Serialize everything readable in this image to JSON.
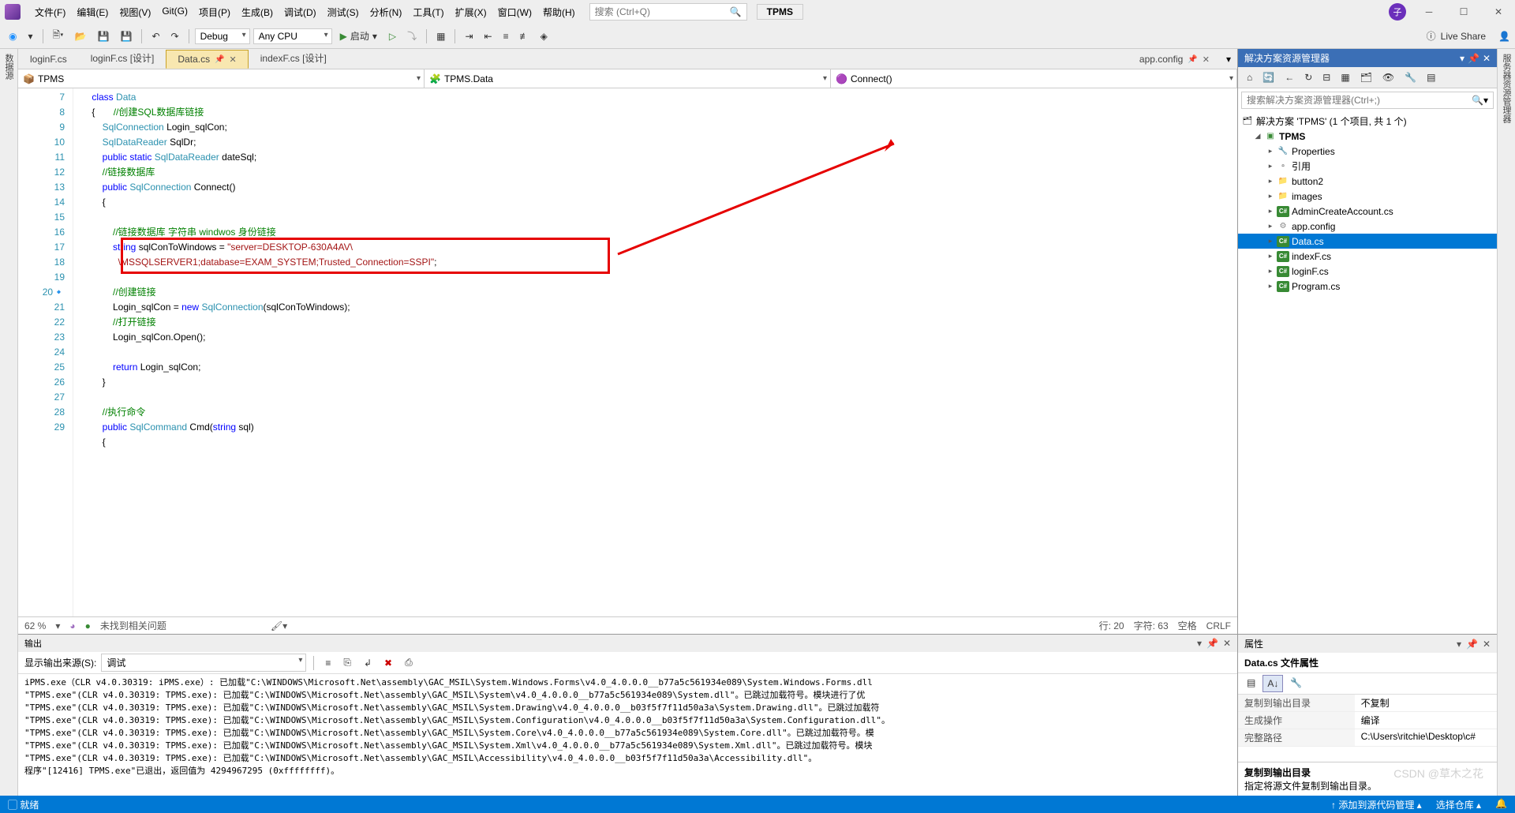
{
  "menu": [
    "文件(F)",
    "编辑(E)",
    "视图(V)",
    "Git(G)",
    "项目(P)",
    "生成(B)",
    "调试(D)",
    "测试(S)",
    "分析(N)",
    "工具(T)",
    "扩展(X)",
    "窗口(W)",
    "帮助(H)"
  ],
  "search_placeholder": "搜索 (Ctrl+Q)",
  "solution_name": "TPMS",
  "user_initial": "子",
  "toolbar": {
    "config": "Debug",
    "platform": "Any CPU",
    "start": "启动"
  },
  "liveshare": "Live Share",
  "left_tool": "数据源",
  "right_tool": "服务器资源管理器",
  "tabs": [
    {
      "label": "loginF.cs",
      "active": false
    },
    {
      "label": "loginF.cs [设计]",
      "active": false
    },
    {
      "label": "Data.cs",
      "active": true,
      "pinned": true
    },
    {
      "label": "indexF.cs [设计]",
      "active": false
    }
  ],
  "extra_tab": "app.config",
  "nav": {
    "ns": "TPMS",
    "cls": "TPMS.Data",
    "member": "Connect()"
  },
  "line_start": 7,
  "line_count": 23,
  "code_lines": [
    "    <span class='kw'>class</span> <span class='type'>Data</span>",
    "    {       <span class='cmt'>//创建SQL数据库链接</span>",
    "        <span class='type'>SqlConnection</span> Login_sqlCon;",
    "        <span class='type'>SqlDataReader</span> SqlDr;",
    "        <span class='kw'>public static</span> <span class='type'>SqlDataReader</span> dateSql;",
    "        <span class='cmt'>//链接数据库</span>",
    "        <span class='kw'>public</span> <span class='type'>SqlConnection</span> Connect()",
    "        {",
    "",
    "            <span class='cmt'>//链接数据库 字符串 windwos 身份链接</span>",
    "            <span class='kw'>string</span> sqlConToWindows = <span class='str'>\"server=DESKTOP-630A4AV\\</span>",
    "<span class='str'>              \\MSSQLSERVER1;database=EXAM_SYSTEM;Trusted_Connection=SSPI\"</span>;",
    "",
    "            <span class='cmt'>//创建链接</span>",
    "            Login_sqlCon = <span class='kw'>new</span> <span class='type'>SqlConnection</span>(sqlConToWindows);",
    "            <span class='cmt'>//打开链接</span>",
    "            Login_sqlCon.Open();",
    "",
    "            <span class='kw'>return</span> Login_sqlCon;",
    "        }",
    "",
    "        <span class='cmt'>//执行命令</span>",
    "        <span class='kw'>public</span> <span class='type'>SqlCommand</span> Cmd(<span class='kw'>string</span> sql)",
    "        {"
  ],
  "status": {
    "zoom": "62 %",
    "issues": "未找到相关问题",
    "line": "行: 20",
    "col": "字符: 63",
    "spc": "空格",
    "eol": "CRLF"
  },
  "output": {
    "title": "输出",
    "from_label": "显示输出来源(S):",
    "from_value": "调试",
    "lines": [
      "iPMS.exe（CLR v4.0.30319: iPMS.exe）: 已加载\"C:\\WINDOWS\\Microsoft.Net\\assembly\\GAC_MSIL\\System.Windows.Forms\\v4.0_4.0.0.0__b77a5c561934e089\\System.Windows.Forms.dll",
      "\"TPMS.exe\"(CLR v4.0.30319: TPMS.exe): 已加载\"C:\\WINDOWS\\Microsoft.Net\\assembly\\GAC_MSIL\\System\\v4.0_4.0.0.0__b77a5c561934e089\\System.dll\"。已跳过加载符号。模块进行了优",
      "\"TPMS.exe\"(CLR v4.0.30319: TPMS.exe): 已加载\"C:\\WINDOWS\\Microsoft.Net\\assembly\\GAC_MSIL\\System.Drawing\\v4.0_4.0.0.0__b03f5f7f11d50a3a\\System.Drawing.dll\"。已跳过加载符",
      "\"TPMS.exe\"(CLR v4.0.30319: TPMS.exe): 已加载\"C:\\WINDOWS\\Microsoft.Net\\assembly\\GAC_MSIL\\System.Configuration\\v4.0_4.0.0.0__b03f5f7f11d50a3a\\System.Configuration.dll\"。",
      "\"TPMS.exe\"(CLR v4.0.30319: TPMS.exe): 已加载\"C:\\WINDOWS\\Microsoft.Net\\assembly\\GAC_MSIL\\System.Core\\v4.0_4.0.0.0__b77a5c561934e089\\System.Core.dll\"。已跳过加载符号。模",
      "\"TPMS.exe\"(CLR v4.0.30319: TPMS.exe): 已加载\"C:\\WINDOWS\\Microsoft.Net\\assembly\\GAC_MSIL\\System.Xml\\v4.0_4.0.0.0__b77a5c561934e089\\System.Xml.dll\"。已跳过加载符号。模块",
      "\"TPMS.exe\"(CLR v4.0.30319: TPMS.exe): 已加载\"C:\\WINDOWS\\Microsoft.Net\\assembly\\GAC_MSIL\\Accessibility\\v4.0_4.0.0.0__b03f5f7f11d50a3a\\Accessibility.dll\"。",
      "程序\"[12416] TPMS.exe\"已退出，返回值为 4294967295 (0xffffffff)。"
    ]
  },
  "solution_explorer": {
    "title": "解决方案资源管理器",
    "search_placeholder": "搜索解决方案资源管理器(Ctrl+;)",
    "root": "解决方案 'TPMS' (1 个项目, 共 1 个)",
    "project": "TPMS",
    "items": [
      {
        "icon": "wrench",
        "label": "Properties"
      },
      {
        "icon": "ref",
        "label": "引用"
      },
      {
        "icon": "fold",
        "label": "button2"
      },
      {
        "icon": "fold",
        "label": "images"
      },
      {
        "icon": "cs",
        "label": "AdminCreateAccount.cs"
      },
      {
        "icon": "cfg",
        "label": "app.config"
      },
      {
        "icon": "cs",
        "label": "Data.cs",
        "selected": true
      },
      {
        "icon": "cs",
        "label": "indexF.cs"
      },
      {
        "icon": "cs",
        "label": "loginF.cs"
      },
      {
        "icon": "cs",
        "label": "Program.cs"
      }
    ]
  },
  "properties": {
    "title": "属性",
    "obj": "Data.cs 文件属性",
    "rows": [
      {
        "k": "复制到输出目录",
        "v": "不复制"
      },
      {
        "k": "生成操作",
        "v": "编译"
      },
      {
        "k": "完整路径",
        "v": "C:\\Users\\ritchie\\Desktop\\c#"
      }
    ],
    "desc_t": "复制到输出目录",
    "desc_b": "指定将源文件复制到输出目录。"
  },
  "bottombar": {
    "ready": "就绪",
    "src": "↑ 添加到源代码管理 ▴",
    "repo": "选择仓库 ▴",
    "bell": "🔔"
  },
  "watermark": "CSDN @草木之花"
}
